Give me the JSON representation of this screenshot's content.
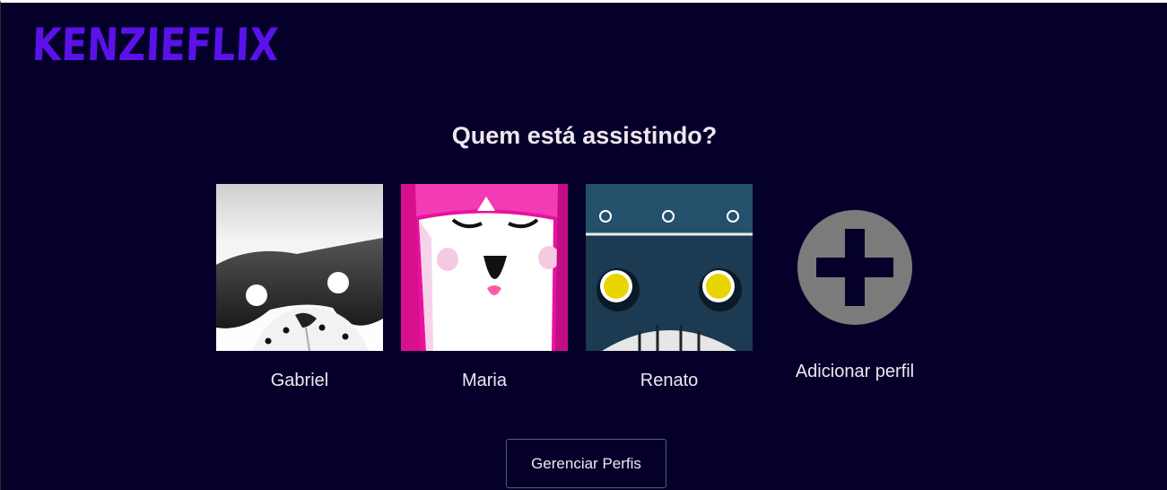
{
  "brand": {
    "logo_text": "KENZIEFLIX",
    "accent": "#5a12e8"
  },
  "page": {
    "title": "Quem está assistindo?",
    "background": "#05002a"
  },
  "profiles": [
    {
      "name": "Gabriel",
      "avatar_icon": "raccoon-avatar-icon"
    },
    {
      "name": "Maria",
      "avatar_icon": "pink-girl-avatar-icon"
    },
    {
      "name": "Renato",
      "avatar_icon": "robot-avatar-icon"
    }
  ],
  "add_profile": {
    "label": "Adicionar perfil",
    "icon": "plus-circle-icon"
  },
  "manage_button": {
    "label": "Gerenciar Perfis"
  }
}
